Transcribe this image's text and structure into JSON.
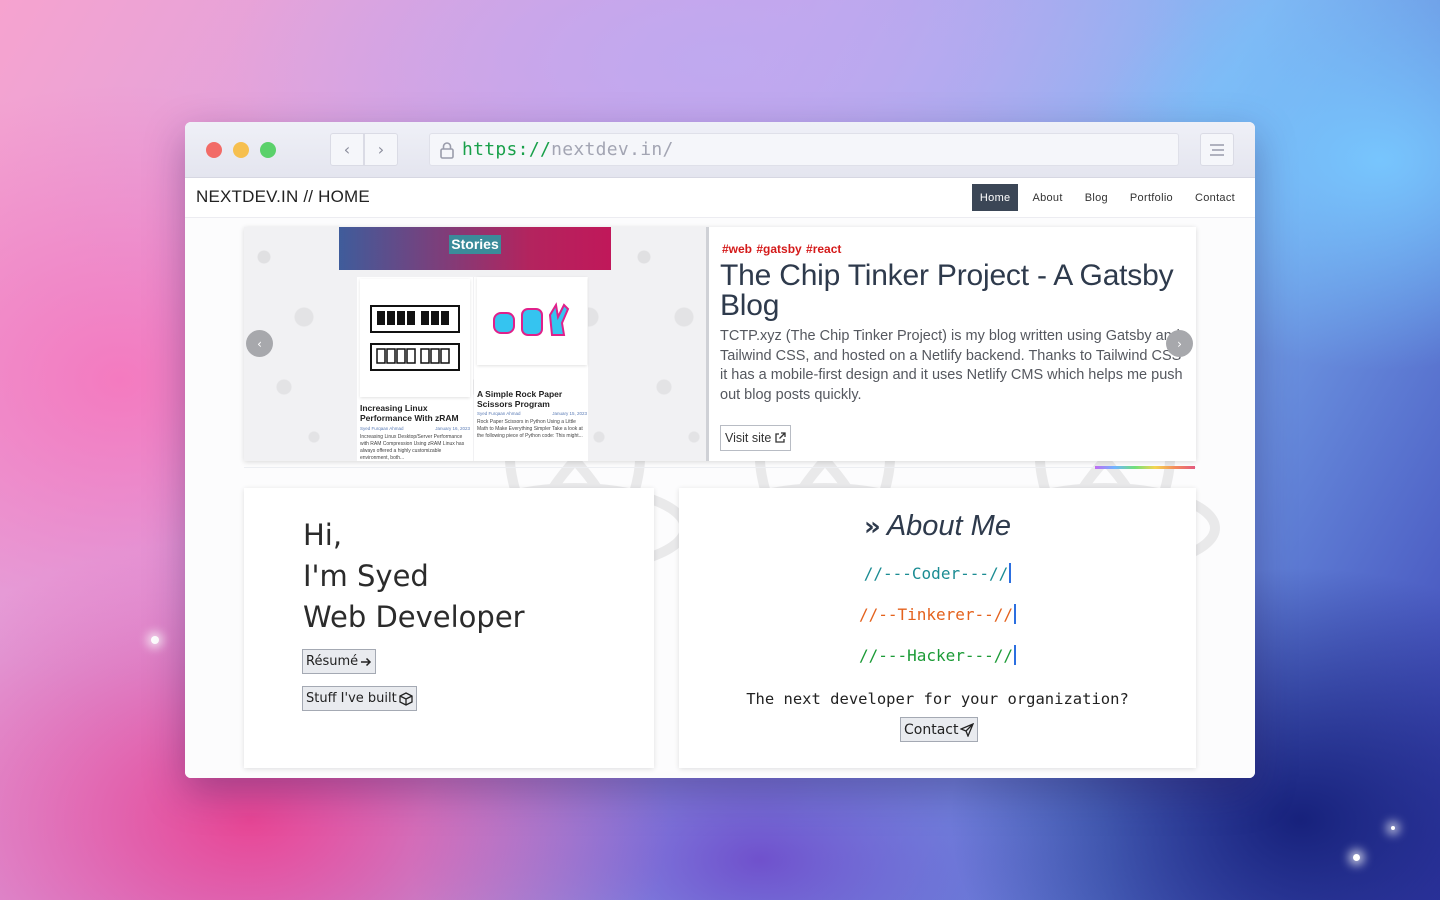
{
  "browser": {
    "url_scheme": "https://",
    "url_host": "nextdev.in/",
    "back_icon": "chevron-left-icon",
    "forward_icon": "chevron-right-icon",
    "menu_icon": "hamburger-icon",
    "lock_icon": "lock-icon"
  },
  "site": {
    "brand": "NEXTDEV.IN // HOME",
    "nav": [
      {
        "label": "Home",
        "active": true
      },
      {
        "label": "About",
        "active": false
      },
      {
        "label": "Blog",
        "active": false
      },
      {
        "label": "Portfolio",
        "active": false
      },
      {
        "label": "Contact",
        "active": false
      }
    ]
  },
  "featured": {
    "screenshot": {
      "header": "Stories",
      "posts": [
        {
          "title": "Increasing Linux Performance With zRAM",
          "author": "Syed Furqaan Ahmad",
          "date": "January 16, 2023",
          "excerpt": "Increasing Linux Desktop/Server Performance with RAM Compression Using zRAM Linux has always offered a highly customizable environment, both..."
        },
        {
          "title": "A Simple Rock Paper Scissors Program",
          "author": "Syed Furqaan Ahmad",
          "date": "January 15, 2023",
          "excerpt": "Rock Paper Scissors in Python Using a Little Math to Make Everything Simpler Take a look at the following piece of Python code: This might..."
        }
      ]
    },
    "tags": "#web #gatsby #react",
    "title": "The Chip Tinker Project - A Gatsby Blog",
    "description": "TCTP.xyz (The Chip Tinker Project) is my blog written using Gatsby and Tailwind CSS, and hosted on a Netlify backend. Thanks to Tailwind CSS it has a mobile-first design and it uses Netlify CMS which helps me push out blog posts quickly.",
    "visit_label": "Visit site",
    "prev_icon": "chevron-left-icon",
    "next_icon": "chevron-right-icon"
  },
  "intro": {
    "line1": "Hi,",
    "line2": "I'm Syed",
    "line3": "Web Developer",
    "resume_label": "Résumé",
    "stuff_label": "Stuff I've built"
  },
  "about": {
    "title": "About Me",
    "roles": [
      "//---Coder---//",
      "//--Tinkerer--//",
      "//---Hacker---//"
    ],
    "tagline": "The next developer for your organization?",
    "contact_label": "Contact"
  },
  "colors": {
    "nav_active": "#3b4656",
    "tag_red": "#d41a1a",
    "coder": "#1b8c93",
    "tinkerer": "#e4621d",
    "hacker": "#1c9b37"
  }
}
